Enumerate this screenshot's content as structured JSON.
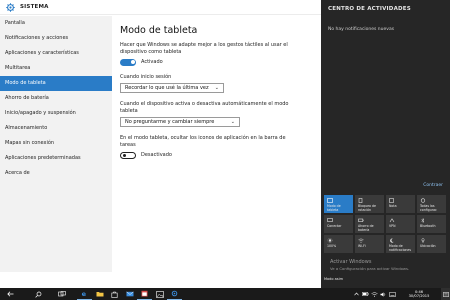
{
  "window": {
    "title": "SISTEMA"
  },
  "sidebar": {
    "items": [
      {
        "label": "Pantalla"
      },
      {
        "label": "Notificaciones y acciones"
      },
      {
        "label": "Aplicaciones y características"
      },
      {
        "label": "Multitarea"
      },
      {
        "label": "Modo de tableta",
        "active": true
      },
      {
        "label": "Ahorro de batería"
      },
      {
        "label": "Inicio/apagado y suspensión"
      },
      {
        "label": "Almacenamiento"
      },
      {
        "label": "Mapas sin conexión"
      },
      {
        "label": "Aplicaciones predeterminadas"
      },
      {
        "label": "Acerca de"
      }
    ]
  },
  "content": {
    "title": "Modo de tableta",
    "tablet_desc": "Hacer que Windows se adapte mejor a los gestos táctiles al usar el dispositivo como tableta",
    "tablet_toggle_state": "on",
    "tablet_toggle_label": "Activado",
    "signin_label": "Cuando inicio sesión",
    "signin_value": "Recordar lo que usé la última vez",
    "switch_label": "Cuando el dispositivo activa o desactiva automáticamente el modo tableta",
    "switch_value": "No preguntarme y cambiar siempre",
    "hide_icons_label": "En el modo tableta, ocultar los iconos de aplicación en la barra de tareas",
    "hide_icons_state": "off",
    "hide_icons_toggle_label": "Desactivado"
  },
  "action_center": {
    "title": "CENTRO DE ACTIVIDADES",
    "empty_text": "No hay notificaciones nuevas",
    "collapse_label": "Contraer",
    "tiles": [
      {
        "label": "Modo de tableta",
        "icon": "tablet-mode-icon",
        "active": true
      },
      {
        "label": "Bloqueo de rotación",
        "icon": "rotation-lock-icon",
        "active": false
      },
      {
        "label": "Nota",
        "icon": "note-icon",
        "active": false
      },
      {
        "label": "Todas las configurac",
        "icon": "settings-icon",
        "active": false
      },
      {
        "label": "Conectar",
        "icon": "connect-icon",
        "active": false
      },
      {
        "label": "Ahorro de batería",
        "icon": "battery-saver-icon",
        "active": false
      },
      {
        "label": "VPN",
        "icon": "vpn-icon",
        "active": false
      },
      {
        "label": "Bluetooth",
        "icon": "bluetooth-icon",
        "active": false
      },
      {
        "label": "100%",
        "icon": "brightness-icon",
        "active": false
      },
      {
        "label": "Wi-Fi",
        "icon": "wifi-icon",
        "active": false
      },
      {
        "label": "Modo de notificaciones",
        "icon": "quiet-hours-icon",
        "active": false
      },
      {
        "label": "Ubicación",
        "icon": "location-icon",
        "active": false
      }
    ],
    "watermark": "Activar Windows",
    "watermark_sub": "Ve a Configuración para activar Windows.",
    "mini_label": "Modo asim"
  },
  "taskbar": {
    "apps": [
      {
        "name": "edge-icon",
        "color": "#3b8fe0"
      },
      {
        "name": "file-explorer-icon",
        "color": "#f3c545"
      },
      {
        "name": "store-icon",
        "color": "#ffffff"
      },
      {
        "name": "mail-icon",
        "color": "#3b8fe0"
      },
      {
        "name": "calendar-icon",
        "color": "#d94a4a"
      },
      {
        "name": "photos-icon",
        "color": "#ffffff"
      },
      {
        "name": "settings-icon",
        "color": "#3b8fe0"
      }
    ],
    "time": "0:46",
    "date": "30/07/2015"
  },
  "colors": {
    "accent": "#2a7cc7",
    "action_center_bg": "#262626",
    "taskbar_bg": "#1a1a1a"
  }
}
